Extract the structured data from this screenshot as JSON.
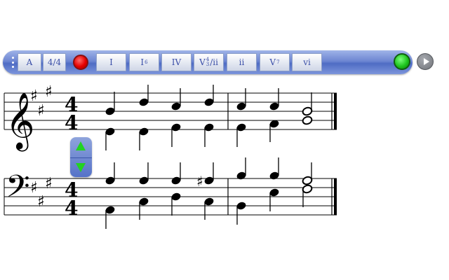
{
  "toolbar": {
    "key_label": "A",
    "meter_label": "4/4",
    "chords": [
      {
        "main": "I",
        "sup": ""
      },
      {
        "main": "I",
        "sup": "6"
      },
      {
        "main": "IV",
        "sup": ""
      },
      {
        "main": "V",
        "sup": "4",
        "sub": "3",
        "suffix": "/ii"
      },
      {
        "main": "ii",
        "sup": ""
      },
      {
        "main": "V",
        "sup": "7"
      },
      {
        "main": "vi",
        "sup": ""
      }
    ]
  },
  "score": {
    "treble_time_sig": {
      "top": "4",
      "bottom": "4"
    },
    "bass_time_sig": {
      "top": "4",
      "bottom": "4"
    },
    "sharp_glyph": "♯",
    "treble_clef_glyph": "𝄞",
    "bass_clef_glyph": "𝄢"
  },
  "colors": {
    "toolbar_blue": "#5f79cb",
    "record_red": "#e60000",
    "go_green": "#1ec51e",
    "stepper_arrow": "#22d322"
  }
}
